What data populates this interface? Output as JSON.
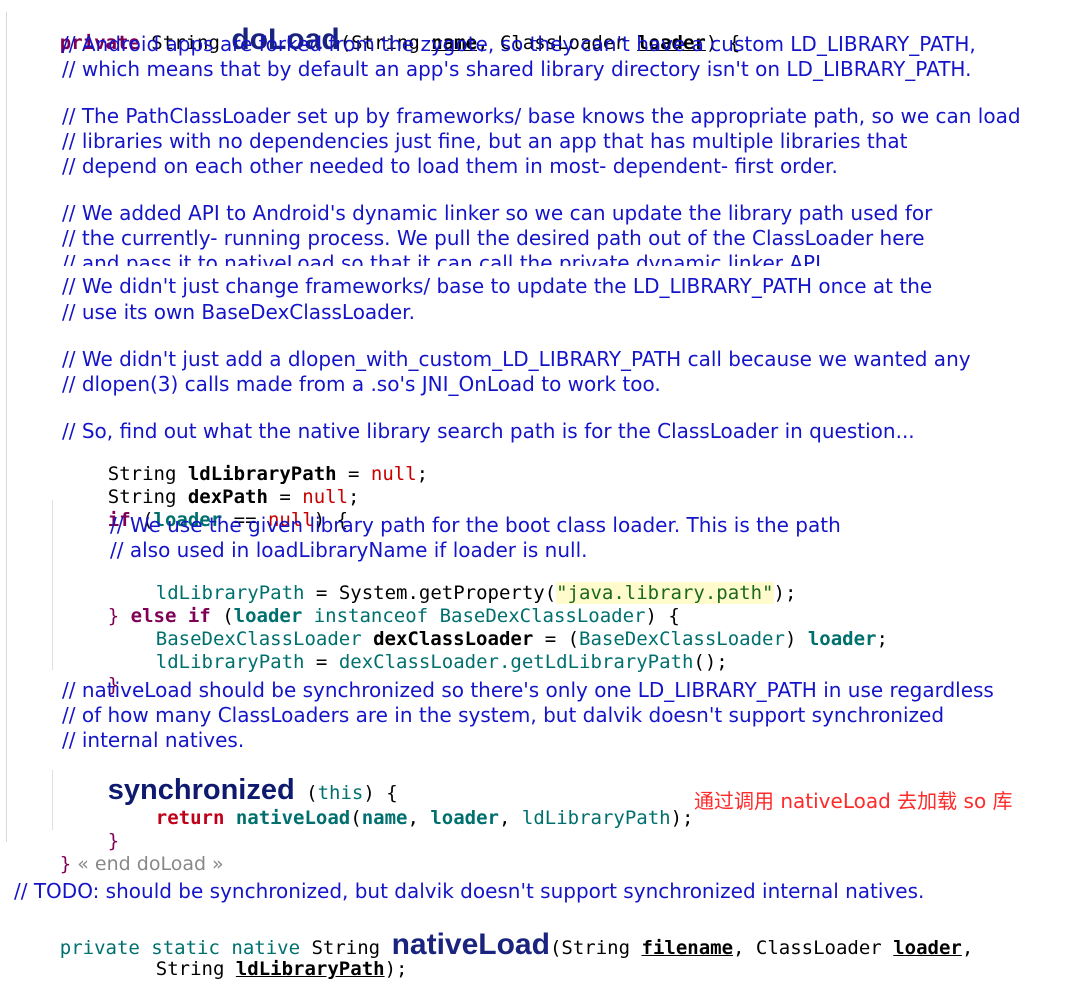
{
  "code": {
    "method_header": {
      "modifier": "private",
      "type": "String",
      "name": "doLoad",
      "open": "(",
      "p1_type": "String",
      "p1_name": "name",
      "comma": ",",
      "p2_type": "ClassLoader",
      "p2_name": "loader",
      "close": ") {"
    },
    "comments": {
      "c1": "// Android apps are forked from the zygote, so they can't have a custom LD_LIBRARY_PATH,",
      "c2": "// which means that by default an app's shared library directory isn't on LD_LIBRARY_PATH.",
      "c3": "// The PathClassLoader set up by frameworks/ base knows the appropriate path, so we can load",
      "c4": "// libraries with no dependencies just fine, but an app that has multiple libraries that",
      "c5": "// depend on each other needed to load them in most- dependent- first order.",
      "c6": "// We added API to Android's dynamic linker so we can update the library path used for",
      "c7": "// the currently- running process. We pull the desired path out of the ClassLoader here",
      "c8": "// and pass it to nativeLoad so that it can call the private dynamic linker API.",
      "c9": "// We didn't just change frameworks/ base to update the LD_LIBRARY_PATH once at the",
      "c10": "// use its own BaseDexClassLoader.",
      "c11": "// We didn't just add a dlopen_with_custom_LD_LIBRARY_PATH call because we wanted any",
      "c12": "// dlopen(3) calls made from a .so's JNI_OnLoad to work too.",
      "c13": "// So, find out what the native library search path is for the ClassLoader in question...",
      "c14": "// We use the given library path for the boot class loader. This is the path",
      "c15": "// also used in loadLibraryName if loader is null.",
      "c16": "// nativeLoad should be synchronized so there's only one LD_LIBRARY_PATH in use regardless",
      "c17": "// of how many ClassLoaders are in the system, but dalvik doesn't support synchronized",
      "c18": "// internal natives.",
      "c19": "// TODO: should be synchronized, but dalvik doesn't support synchronized internal natives."
    },
    "decl1": {
      "type": "String",
      "var": "ldLibraryPath",
      "eq": " = ",
      "val": "null",
      "end": ";"
    },
    "decl2": {
      "type": "String",
      "var": "dexPath",
      "eq": " = ",
      "val": "null",
      "end": ";"
    },
    "if_line": {
      "kw": "if",
      "open": " (",
      "var": "loader",
      "op": " == ",
      "val": "null",
      "close": ") {"
    },
    "assign1": {
      "var": "ldLibraryPath",
      "eq": " = ",
      "cls": "System.getProperty(",
      "str": "\"java.library.path\"",
      "end": ");"
    },
    "elseif_line": {
      "brace": "}",
      "kw1": " else ",
      "kw2": "if",
      "open": " (",
      "var": "loader",
      "op": " instanceof ",
      "cls": "BaseDexClassLoader",
      "close": ") {"
    },
    "cast_line": {
      "type": "BaseDexClassLoader",
      "var": " dexClassLoader",
      "eq": " = (",
      "cls": "BaseDexClassLoader",
      "close": ") ",
      "src": "loader",
      "end": ";"
    },
    "assign2": {
      "var": "ldLibraryPath",
      "eq": " = ",
      "call": "dexClassLoader.getLdLibraryPath",
      "end": "();"
    },
    "close_brace": "}",
    "sync_line": {
      "kw": "synchronized",
      "open": " (",
      "arg": "this",
      "close": ") {"
    },
    "return_line": {
      "kw": "return",
      "fn": "nativeLoad",
      "open": "(",
      "a1": "name",
      "c1": ", ",
      "a2": "loader",
      "c2": ", ",
      "a3": "ldLibraryPath",
      "end": ");"
    },
    "sync_close": "}",
    "end_line": {
      "brace": "}",
      "fold": " « end doLoad »"
    },
    "native_header": {
      "mod1": "private",
      "mod2": "static",
      "mod3": "native",
      "type": "String",
      "name": "nativeLoad",
      "open": "(",
      "p1_type": "String",
      "p1_name": "filename",
      "comma1": ",",
      "p2_type": "ClassLoader",
      "p2_name": "loader",
      "comma2": ","
    },
    "native_header2": {
      "type": "String",
      "name": "ldLibraryPath",
      "end": ");"
    }
  },
  "annotation": "通过调用 nativeLoad 去加载 so 库"
}
